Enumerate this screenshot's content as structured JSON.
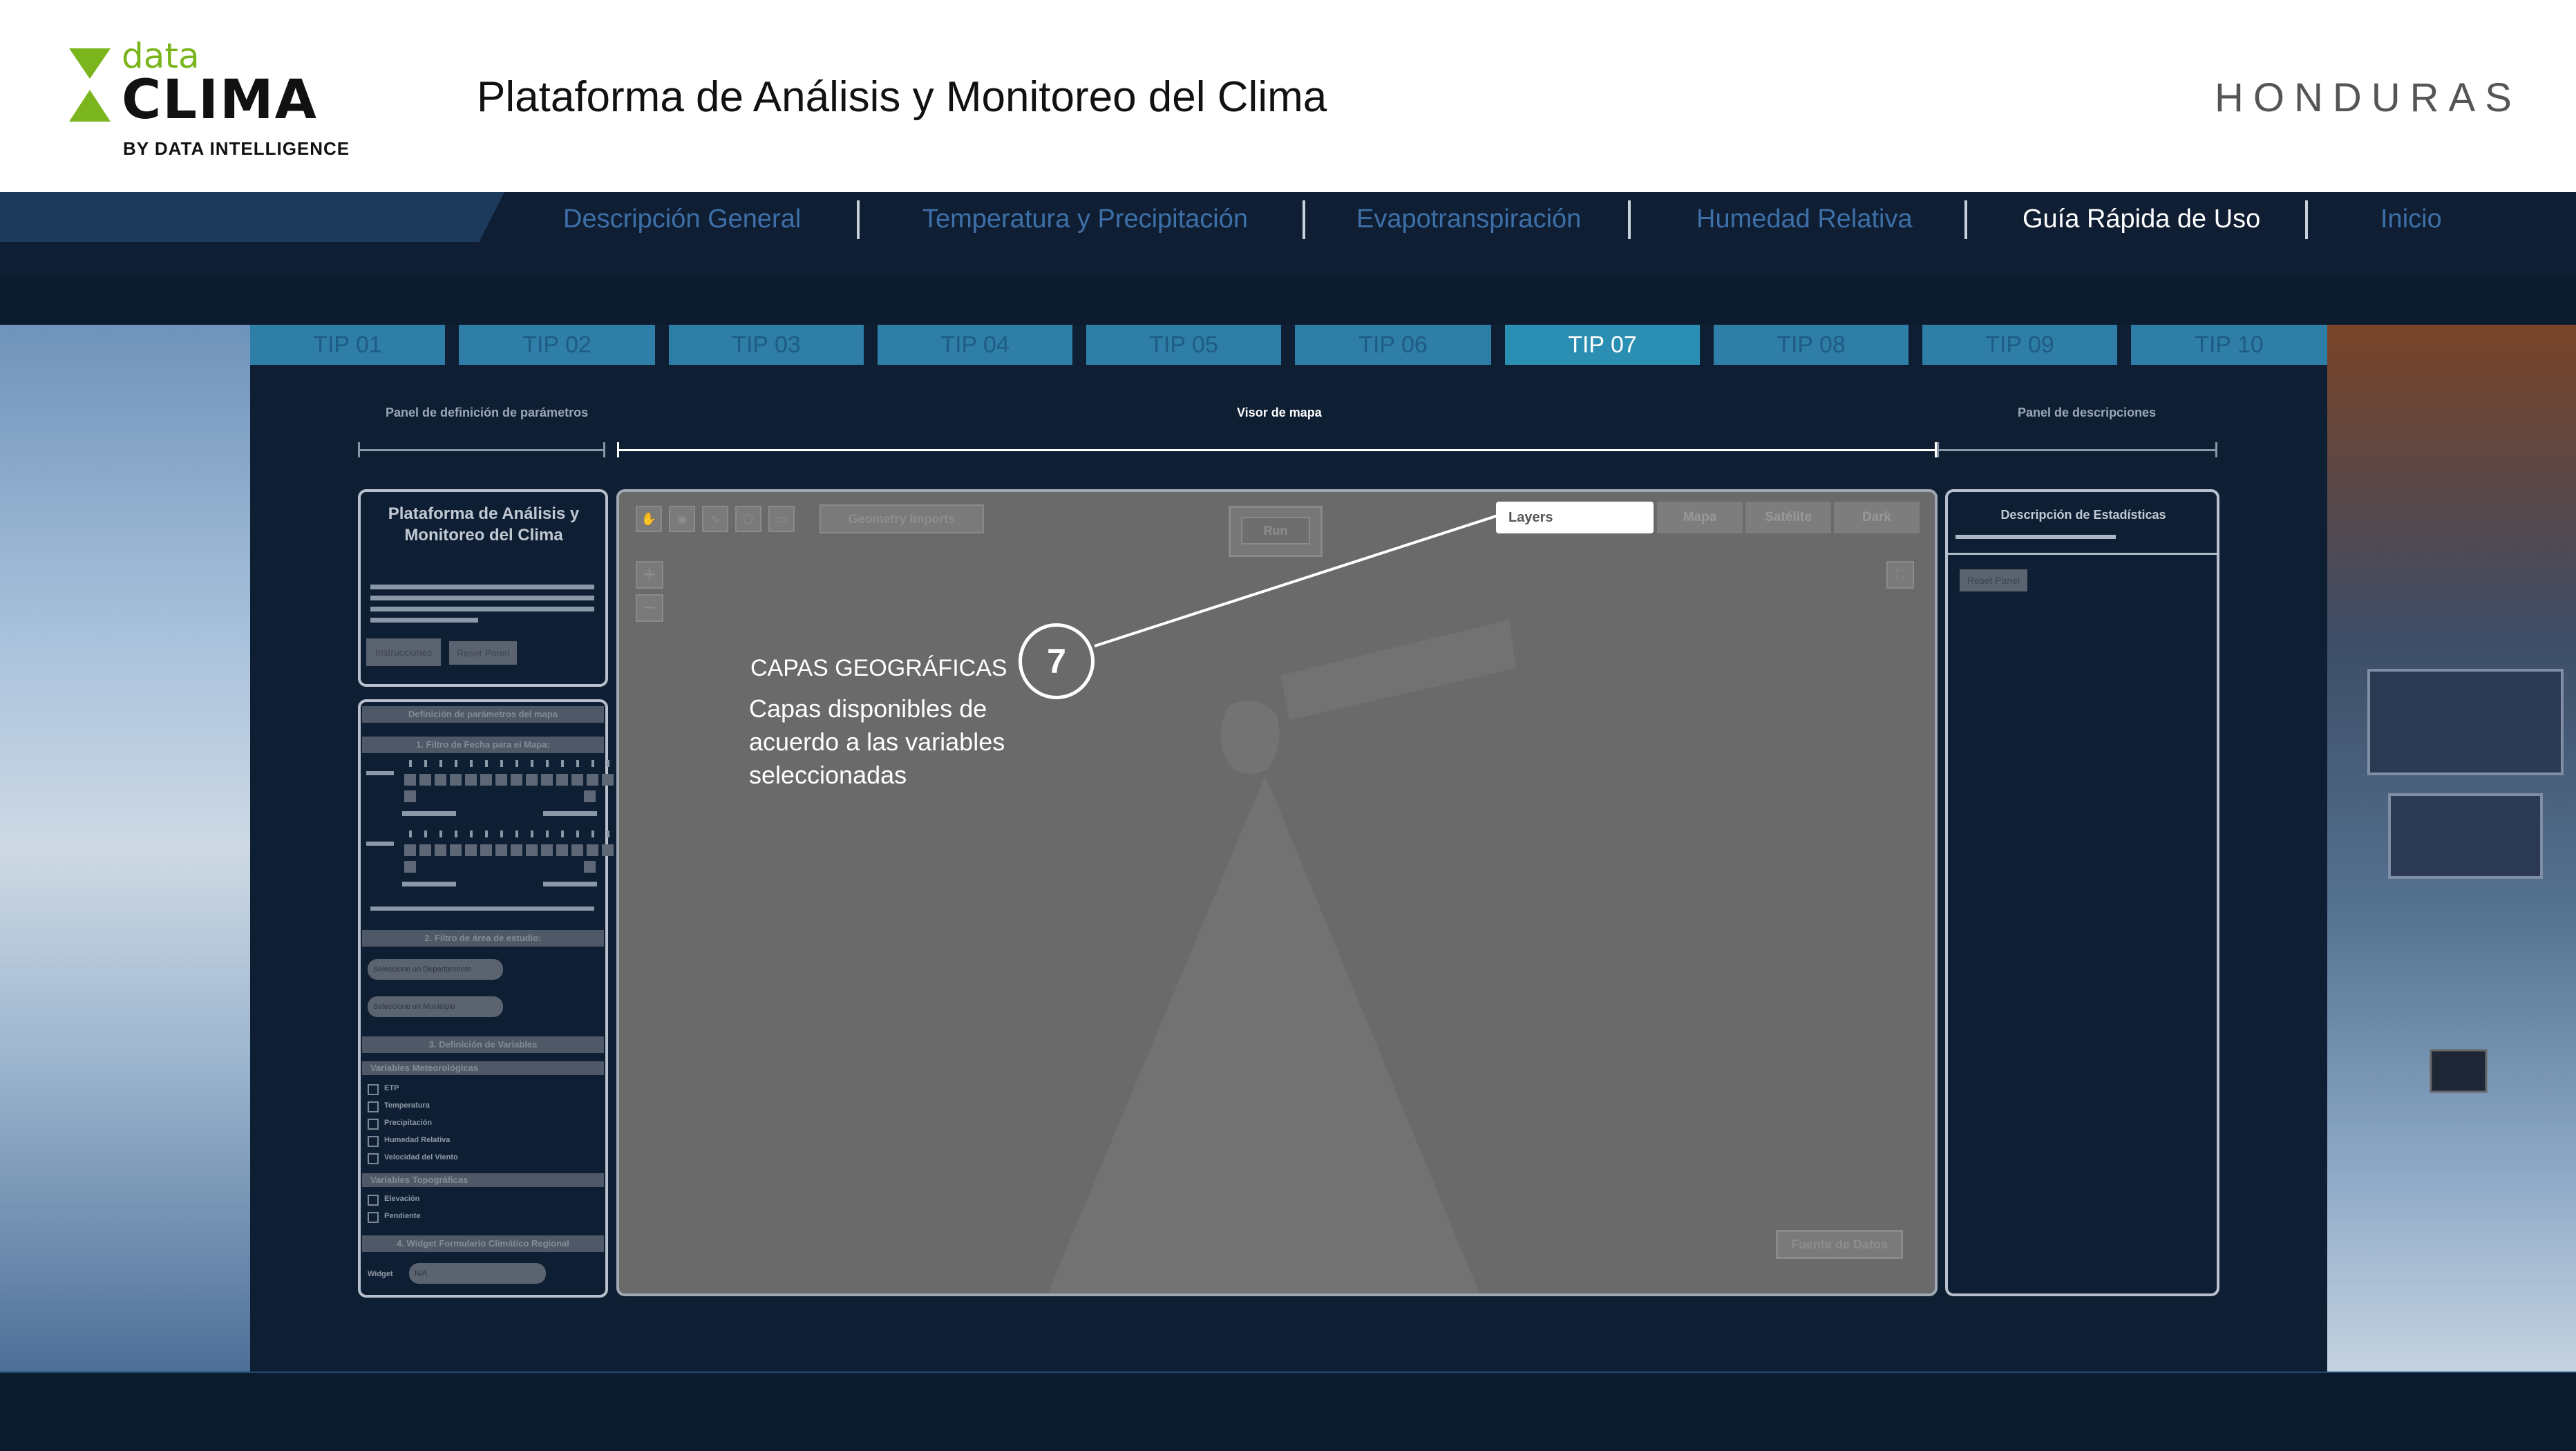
{
  "header": {
    "logo_data": "data",
    "logo_clima": "CLIMA",
    "logo_by": "BY DATA INTELLIGENCE",
    "title": "Plataforma de Análisis y Monitoreo del Clima",
    "country": "HONDURAS"
  },
  "nav": {
    "items": [
      {
        "label": "Descripción General"
      },
      {
        "label": "Temperatura y Precipitación"
      },
      {
        "label": "Evapotranspiración"
      },
      {
        "label": "Humedad Relativa"
      },
      {
        "label": "Guía Rápida de Uso"
      },
      {
        "label": "Inicio"
      }
    ],
    "active_index": 4
  },
  "tips": {
    "items": [
      "TIP 01",
      "TIP 02",
      "TIP 03",
      "TIP 04",
      "TIP 05",
      "TIP 06",
      "TIP 07",
      "TIP 08",
      "TIP 09",
      "TIP 10"
    ],
    "active_index": 6
  },
  "sections": {
    "left": "Panel de definición de  parámetros",
    "center": "Visor de mapa",
    "right": "Panel de descripciones"
  },
  "left_panel": {
    "title": "Plataforma de Análisis y Monitoreo del Clima",
    "btn_instructions": "Instrucciones",
    "btn_reset": "Reset Panel",
    "params_title": "Definición de parámetros del mapa",
    "filter_dates": "1. Filtro de Fecha para el Mapa:",
    "filter_area": "2. Filtro de área de estudio:",
    "select_dept": "Seleccione un Departamento",
    "select_muni": "Seleccione un Municipio",
    "vars_title": "3. Definición de Variables",
    "vars_meteo": "Variables Meteorológicas",
    "var_items": [
      "ETP",
      "Temperatura",
      "Precipitación",
      "Humedad Relativa",
      "Velocidad del Viento"
    ],
    "vars_topo": "Variables Topográficas",
    "topo_items": [
      "Elevación",
      "Pendiente"
    ],
    "widget_title": "4. Widget Formulario Climático Regional",
    "widget_label": "Widget",
    "widget_value": "N/A"
  },
  "map": {
    "geometry_imports": "Geometry Imports",
    "run": "Run",
    "layers": "Layers",
    "tabs": [
      "Mapa",
      "Satélite",
      "Dark"
    ],
    "zoom_in": "+",
    "zoom_out": "−",
    "sources": "Fuente de Datos"
  },
  "callout": {
    "number": "7",
    "title": "CAPAS GEOGRÁFICAS",
    "body": "Capas disponibles de acuerdo a las variables seleccionadas"
  },
  "right_panel": {
    "title": "Descripción de Estadísticas",
    "reset": "Reset Panel"
  },
  "colors": {
    "background": "#0d1b2e",
    "nav_link": "#3d6fa8",
    "tip_bg": "#2e7ea8",
    "accent_green": "#7ab51d",
    "accent_red": "#e0302a"
  }
}
